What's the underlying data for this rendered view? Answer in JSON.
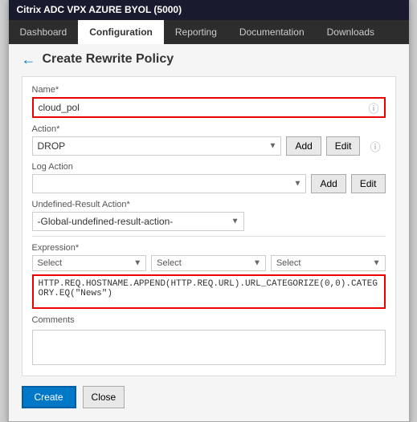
{
  "titleBar": {
    "text": "Citrix ADC VPX AZURE BYOL (5000)"
  },
  "nav": {
    "items": [
      {
        "label": "Dashboard",
        "active": false
      },
      {
        "label": "Configuration",
        "active": true
      },
      {
        "label": "Reporting",
        "active": false
      },
      {
        "label": "Documentation",
        "active": false
      },
      {
        "label": "Downloads",
        "active": false
      }
    ]
  },
  "page": {
    "back_icon": "←",
    "title": "Create Rewrite Policy"
  },
  "form": {
    "name_label": "Name*",
    "name_value": "cloud_pol",
    "action_label": "Action*",
    "action_value": "DROP",
    "action_add": "Add",
    "action_edit": "Edit",
    "log_action_label": "Log Action",
    "log_add": "Add",
    "log_edit": "Edit",
    "undefined_label": "Undefined-Result Action*",
    "undefined_value": "-Global-undefined-result-action-",
    "expression_label": "Expression*",
    "expression_selects": [
      "Select",
      "Select",
      "Select"
    ],
    "expression_value": "HTTP.REQ.HOSTNAME.APPEND(HTTP.REQ.URL).URL_CATEGORIZE(0,0).CATEGORY.EQ(\"News\")",
    "comments_label": "Comments",
    "comments_value": "",
    "create_btn": "Create",
    "close_btn": "Close"
  }
}
